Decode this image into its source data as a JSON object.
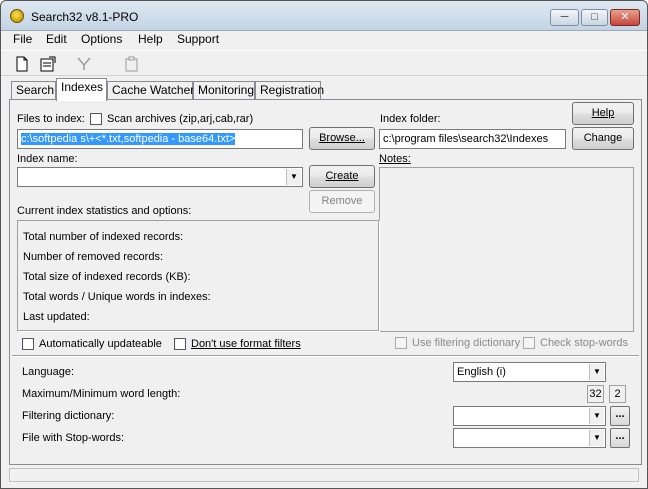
{
  "window": {
    "title": "Search32 v8.1-PRO",
    "minimize": "─",
    "maximize": "□",
    "close": "✕"
  },
  "menu": [
    "File",
    "Edit",
    "Options",
    "Help",
    "Support"
  ],
  "toolbar": {
    "icons": [
      "new-document-icon",
      "properties-icon",
      "filter-icon",
      "clipboard-icon"
    ]
  },
  "tabs": [
    "Search",
    "Indexes",
    "Cache Watcher",
    "Monitoring",
    "Registration"
  ],
  "active_tab": "Indexes",
  "files": {
    "label": "Files to index:",
    "scan_archives_label": "Scan archives (zip,arj,cab,rar)",
    "value": "c:\\softpedia s\\+<*.txt,softpedia - base64.txt>",
    "browse": "Browse..."
  },
  "index_name": {
    "label": "Index name:",
    "value": "",
    "create": "Create",
    "remove": "Remove"
  },
  "index_folder": {
    "label": "Index folder:",
    "value": "c:\\program files\\search32\\Indexes",
    "help": "Help",
    "change": "Change"
  },
  "notes": {
    "label": "Notes:"
  },
  "stats": {
    "label": "Current index statistics and options:",
    "rows": [
      "Total number of indexed records:",
      "Number of removed records:",
      "Total size of indexed records (KB):",
      "Total words / Unique words in indexes:",
      "Last updated:"
    ]
  },
  "options": {
    "auto_update": "Automatically updateable",
    "no_format_filters": "Don't use format filters",
    "use_filter_dict": "Use filtering dictionary",
    "check_stop_words": "Check stop-words"
  },
  "settings": {
    "language_label": "Language:",
    "language_value": "English (i)",
    "word_length_label": "Maximum/Minimum word length:",
    "max_len": "32",
    "min_len": "2",
    "filter_dict_label": "Filtering dictionary:",
    "stop_words_label": "File with Stop-words:",
    "ellipsis": "..."
  }
}
